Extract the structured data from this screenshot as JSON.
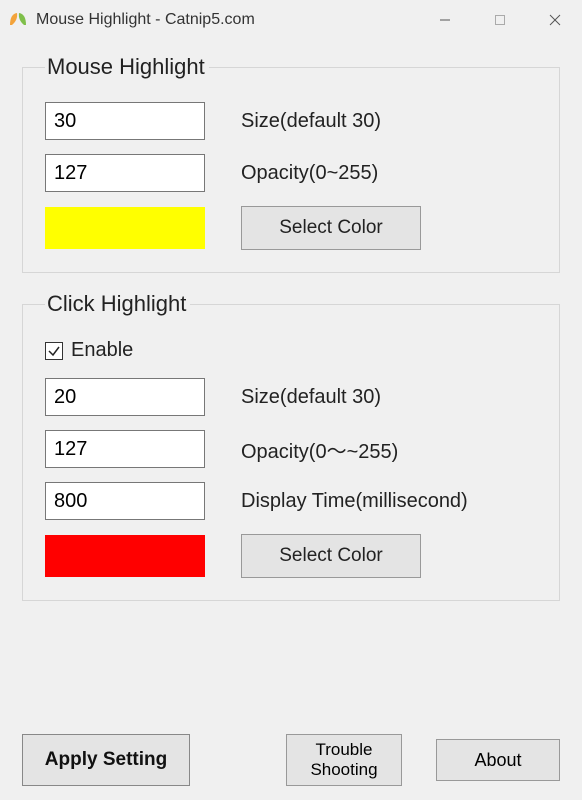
{
  "window": {
    "title": "Mouse Highlight - Catnip5.com"
  },
  "mouse_highlight": {
    "legend": "Mouse Highlight",
    "size_value": "30",
    "size_label": "Size(default 30)",
    "opacity_value": "127",
    "opacity_label": "Opacity(0~255)",
    "color": "#ffff00",
    "select_color_label": "Select Color"
  },
  "click_highlight": {
    "legend": "Click Highlight",
    "enable_label": "Enable",
    "enable_checked": true,
    "size_value": "20",
    "size_label": "Size(default 30)",
    "opacity_value": "127",
    "opacity_label": "Opacity(0～~255)",
    "display_time_value": "800",
    "display_time_label": "Display Time(millisecond)",
    "color": "#ff0000",
    "select_color_label": "Select Color"
  },
  "buttons": {
    "apply": "Apply Setting",
    "trouble_l1": "Trouble",
    "trouble_l2": "Shooting",
    "about": "About"
  }
}
